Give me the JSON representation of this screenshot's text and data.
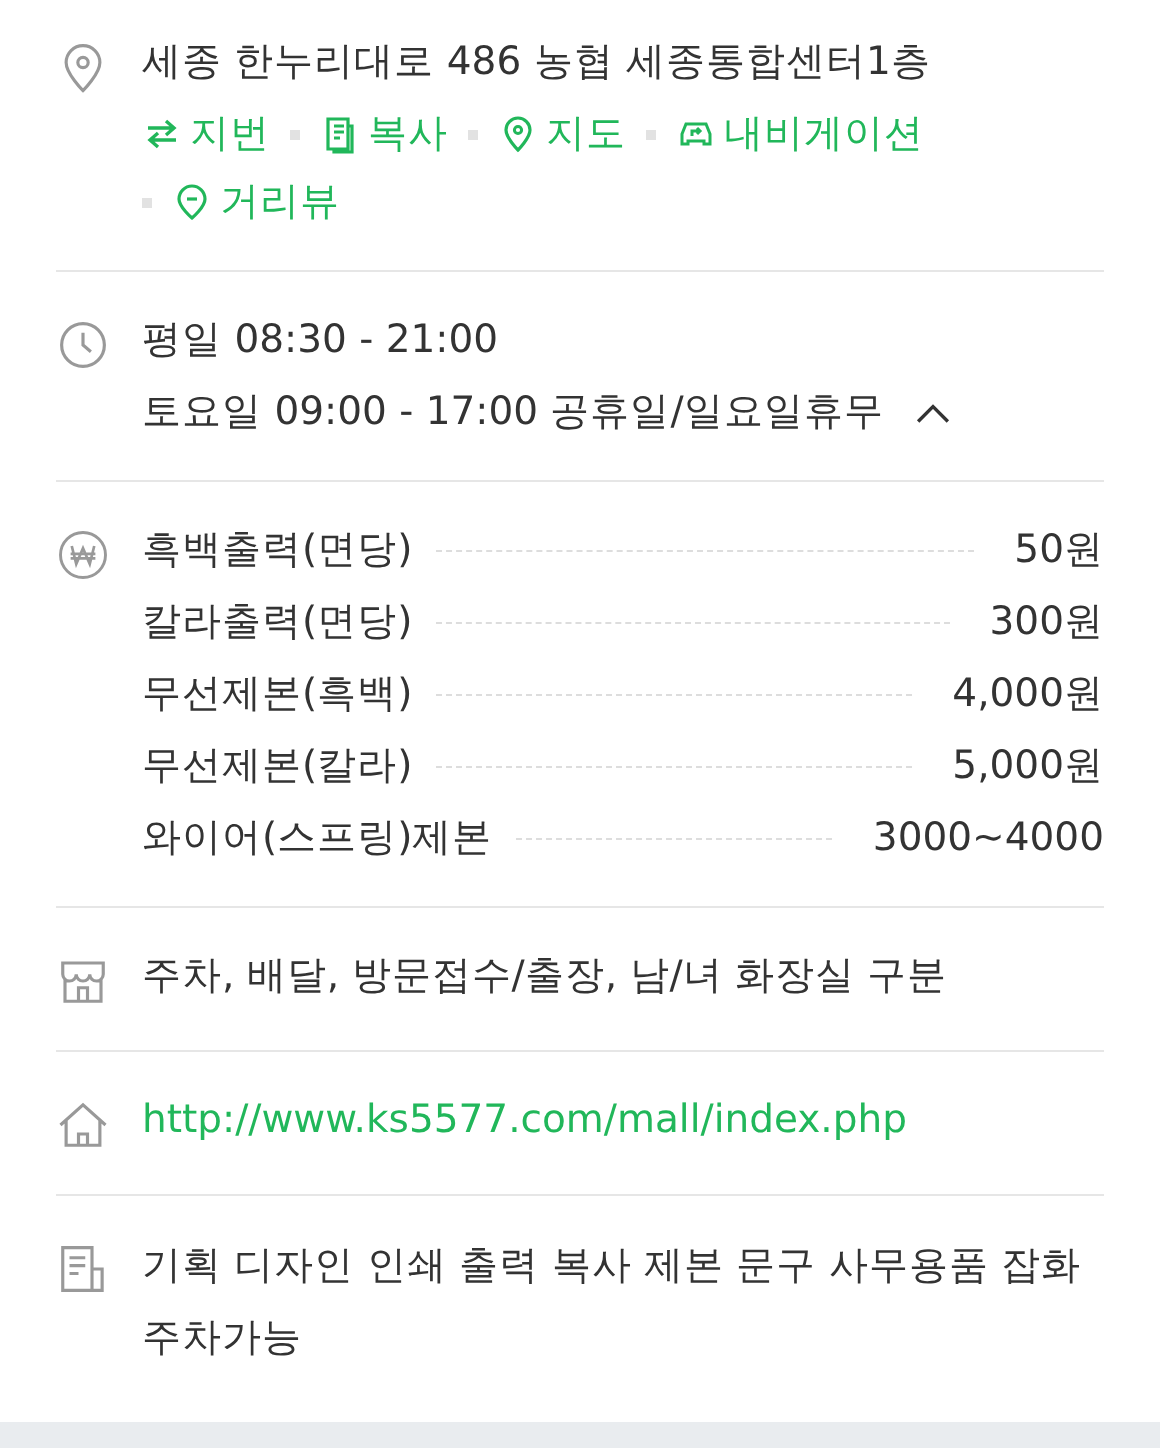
{
  "address": {
    "text": "세종 한누리대로 486 농협 세종통합센터1층",
    "actions": [
      {
        "kind": "swap",
        "label": "지번"
      },
      {
        "kind": "copy",
        "label": "복사"
      },
      {
        "kind": "pin",
        "label": "지도"
      },
      {
        "kind": "car",
        "label": "내비게이션"
      },
      {
        "kind": "street",
        "label": "거리뷰"
      }
    ]
  },
  "hours": {
    "lines": [
      "평일 08:30 - 21:00",
      "토요일 09:00 - 17:00 공휴일/일요일휴무"
    ],
    "expanded": true
  },
  "prices": [
    {
      "item": "흑백출력(면당)",
      "price": "50원"
    },
    {
      "item": "칼라출력(면당)",
      "price": "300원"
    },
    {
      "item": "무선제본(흑백)",
      "price": "4,000원"
    },
    {
      "item": "무선제본(칼라)",
      "price": "5,000원"
    },
    {
      "item": "와이어(스프링)제본",
      "price": "3000~4000"
    }
  ],
  "facilities": "주차, 배달, 방문접수/출장, 남/녀 화장실 구분",
  "website": "http://www.ks5577.com/mall/index.php",
  "description": "기획 디자인 인쇄 출력 복사 제본 문구 사무용품 잡화 주차가능"
}
